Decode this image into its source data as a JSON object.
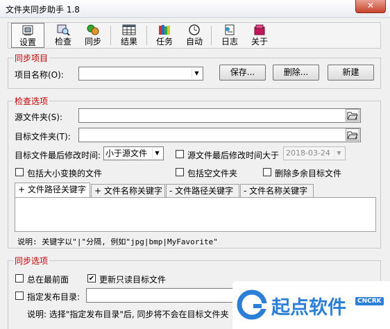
{
  "window": {
    "title": "文件夹同步助手 1.8",
    "close": "✕"
  },
  "toolbar": {
    "items": [
      {
        "label": "设置",
        "icon": "settings-icon"
      },
      {
        "label": "检查",
        "icon": "check-icon"
      },
      {
        "label": "同步",
        "icon": "sync-icon"
      },
      {
        "label": "结果",
        "icon": "results-icon"
      },
      {
        "label": "任务",
        "icon": "tasks-icon"
      },
      {
        "label": "自动",
        "icon": "clock-icon"
      },
      {
        "label": "日志",
        "icon": "log-icon"
      },
      {
        "label": "关于",
        "icon": "about-icon"
      }
    ]
  },
  "sync_project": {
    "legend": "同步项目",
    "name_label": "项目名称(O):",
    "name_value": "",
    "save": "保存...",
    "delete": "删除...",
    "new": "新建"
  },
  "check_options": {
    "legend": "检查选项",
    "source_label": "源文件夹(S):",
    "source_value": "",
    "target_label": "目标文件夹(T):",
    "target_value": "",
    "modtime_label": "目标文件最后修改时间:",
    "modtime_select": "小于源文件",
    "source_mod_label": "源文件最后修改时间大于",
    "source_mod_date": "2018-03-24",
    "case_label": "包括大小变换的文件",
    "empty_label": "包括空文件夹",
    "delete_extra_label": "删除多余目标文件",
    "tabs": [
      "+ 文件路径关键字",
      "+ 文件名称关键字",
      "- 文件路径关键字",
      "- 文件名称关键字"
    ],
    "keywords_value": "",
    "note": "说明: 关键字以\"|\"分隔, 例如\"jpg|bmp|MyFavorite\""
  },
  "sync_options": {
    "legend": "同步选项",
    "top_label": "总在最前面",
    "readonly_label": "更新只读目标文件",
    "readonly_checked": "✔",
    "publish_label": "指定发布目录:",
    "publish_value": "",
    "note": "说明: 选择\"指定发布目录\"后, 同步将不会在目标文件夹"
  },
  "watermark": {
    "text": "起点软件",
    "badge": "CNCRK",
    "color": "#2b7fd6"
  }
}
